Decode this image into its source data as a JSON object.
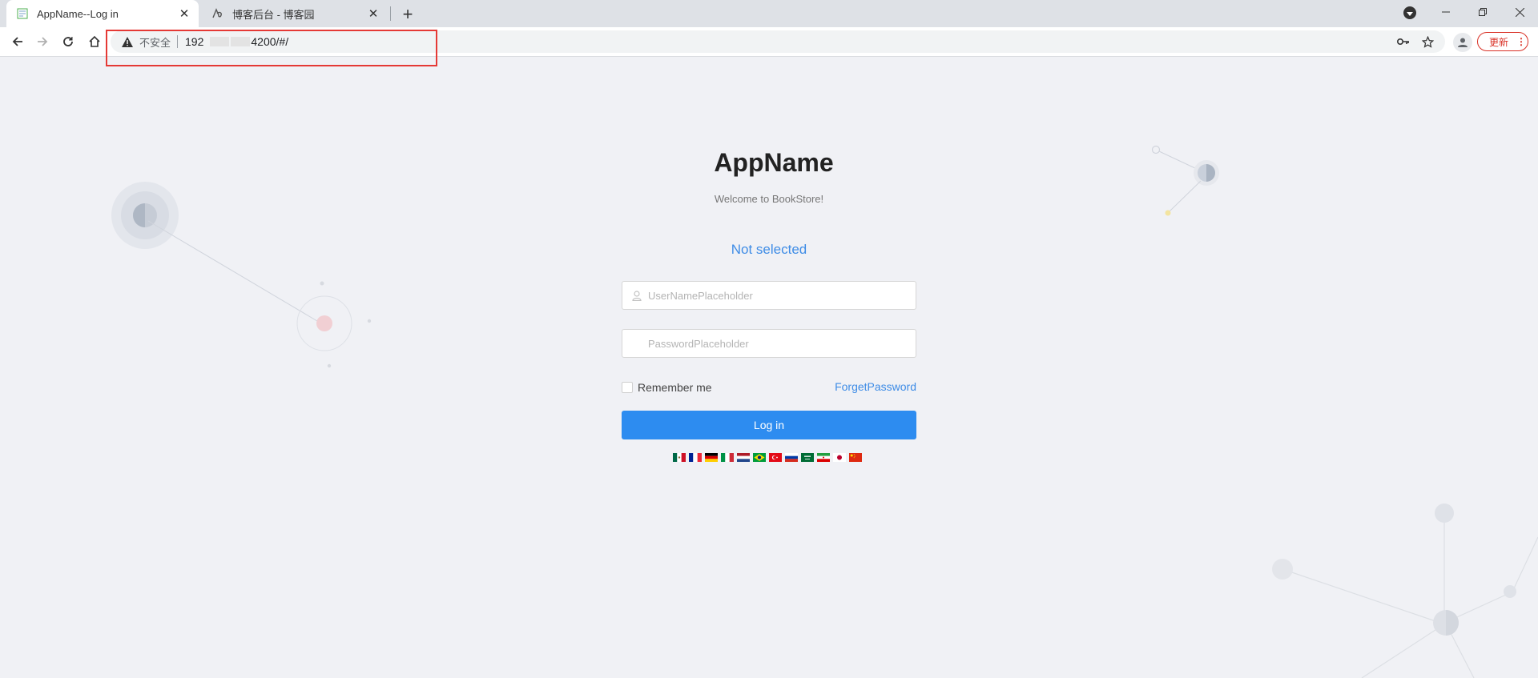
{
  "browser": {
    "tabs": [
      {
        "title": "AppName--Log in",
        "active": true
      },
      {
        "title": "博客后台 - 博客园",
        "active": false
      }
    ],
    "address_bar": {
      "security_label": "不安全",
      "url_prefix": "192",
      "url_suffix": "4200/#/"
    },
    "update_label": "更新",
    "menu_dots": "⋮",
    "accent_color": "#d93025"
  },
  "login": {
    "app_name": "AppName",
    "welcome": "Welcome to BookStore!",
    "tenant_status": "Not selected",
    "username_placeholder": "UserNamePlaceholder",
    "password_placeholder": "PasswordPlaceholder",
    "remember_me": "Remember me",
    "forget_password": "ForgetPassword",
    "login_button": "Log in",
    "primary_color": "#2d8cf0",
    "language_flags": [
      "mexico",
      "france",
      "germany",
      "italy",
      "netherlands",
      "brazil",
      "turkey",
      "russia",
      "saudi-arabia",
      "iran",
      "japan",
      "china"
    ]
  }
}
